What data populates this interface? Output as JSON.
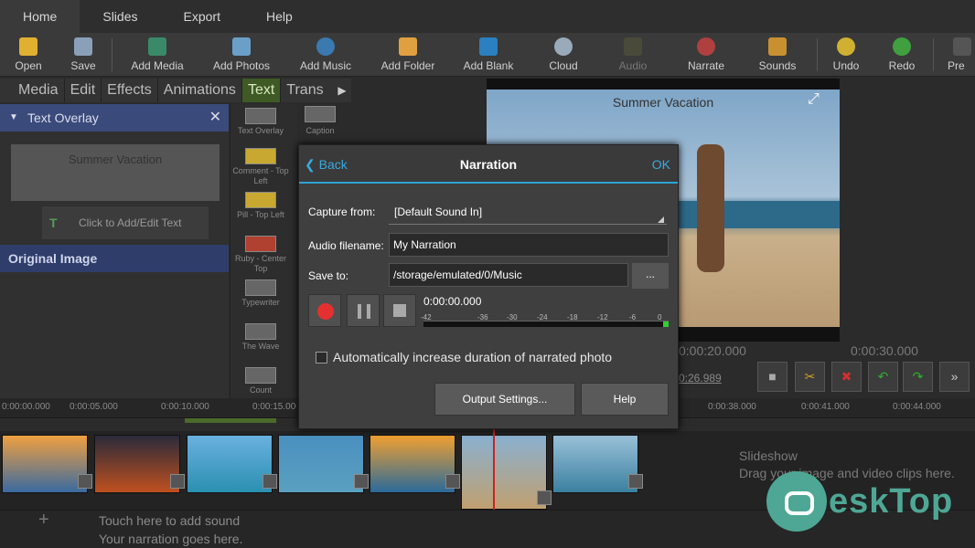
{
  "menubar": {
    "items": [
      "Home",
      "Slides",
      "Export",
      "Help"
    ]
  },
  "toolbar": {
    "items": [
      "Open",
      "Save",
      "Add Media",
      "Add Photos",
      "Add Music",
      "Add Folder",
      "Add Blank",
      "Cloud",
      "Audio",
      "Narrate",
      "Sounds",
      "Undo",
      "Redo",
      "Pre"
    ]
  },
  "tabs": [
    "Media",
    "Edit",
    "Effects",
    "Animations",
    "Text",
    "Trans"
  ],
  "text_overlay": {
    "header": "Text Overlay",
    "text": "Summer Vacation",
    "add_edit": "Click to Add/Edit Text",
    "original_image": "Original Image"
  },
  "gallery": {
    "items": [
      "Text Overlay",
      "Comment - Top Left",
      "Pill - Top Left",
      "Ruby - Center Top",
      "Typewriter",
      "The Wave",
      "Count"
    ],
    "caption": "Caption"
  },
  "preview": {
    "title": "Summer Vacation"
  },
  "dialog": {
    "back": "Back",
    "title": "Narration",
    "ok": "OK",
    "capture_label": "Capture from:",
    "capture_value": "[Default Sound In]",
    "filename_label": "Audio filename:",
    "filename_value": "My Narration",
    "saveto_label": "Save to:",
    "saveto_value": "/storage/emulated/0/Music",
    "browse": "...",
    "timer": "0:00:00.000",
    "meter_labels": [
      "-42",
      "-36",
      "-30",
      "-24",
      "-18",
      "-12",
      "-6",
      "0"
    ],
    "auto_label": "Automatically increase duration of narrated photo",
    "output_settings": "Output Settings...",
    "help": "Help"
  },
  "timeline": {
    "ruler": [
      "0:00:00.000",
      "0:00:05.000",
      "0:00:10.000",
      "0:00:15.000",
      "0:00:38.000",
      "0:00:41.000",
      "0:00:44.000"
    ],
    "right_times": [
      "0:00:20.000",
      "0:00:30.000"
    ],
    "current": "0:26.989",
    "slideshow_title": "Slideshow",
    "slideshow_hint": "Drag your image and video clips here.",
    "add_sound": "Touch here to add sound",
    "narration_hint": "Your narration goes here."
  },
  "logo": {
    "text": "eskTop"
  },
  "colors": {
    "accent": "#2fa3d6",
    "active_tab": "#3f5a25",
    "record": "#e53030",
    "overlay_header": "#3a4a7a"
  }
}
